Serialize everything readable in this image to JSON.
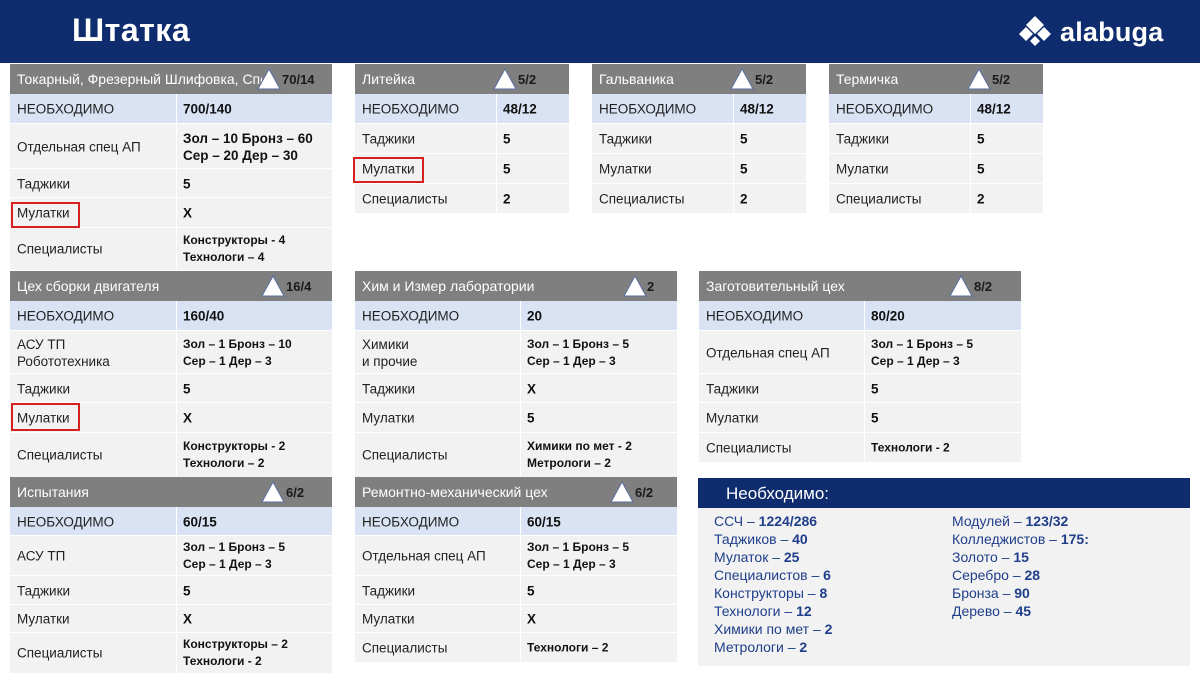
{
  "header": {
    "title": "Штатка",
    "logo_text": "alabuga"
  },
  "colors": {
    "header_bg": "#0f2d6e",
    "block_header": "#7f7f7f",
    "row_blue": "#dae3f3",
    "row_gray": "#f2f2f2",
    "highlight": "#d42020"
  },
  "blocks": {
    "tokarny": {
      "title": "Токарный, Фрезерный Шлифовка, Спец",
      "count": "70/14",
      "rows": [
        {
          "label": "НЕОБХОДИМО",
          "value": "700/140"
        },
        {
          "label": "Отдельная спец АП",
          "line1": "Зол – 10  Бронз – 60",
          "line2": "Сер – 20  Дер – 30"
        },
        {
          "label": "Таджики",
          "value": "5"
        },
        {
          "label": "Мулатки",
          "value": "X"
        },
        {
          "label": "Специалисты",
          "line1": "Конструкторы - 4",
          "line2": "Технологи – 4"
        }
      ]
    },
    "liteyka": {
      "title": "Литейка",
      "count": "5/2",
      "rows": [
        {
          "label": "НЕОБХОДИМО",
          "value": "48/12"
        },
        {
          "label": "Таджики",
          "value": "5"
        },
        {
          "label": "Мулатки",
          "value": "5"
        },
        {
          "label": "Специалисты",
          "value": "2"
        }
      ]
    },
    "galvanika": {
      "title": "Гальваника",
      "count": "5/2",
      "rows": [
        {
          "label": "НЕОБХОДИМО",
          "value": "48/12"
        },
        {
          "label": "Таджики",
          "value": "5"
        },
        {
          "label": "Мулатки",
          "value": "5"
        },
        {
          "label": "Специалисты",
          "value": "2"
        }
      ]
    },
    "termichka": {
      "title": "Термичка",
      "count": "5/2",
      "rows": [
        {
          "label": "НЕОБХОДИМО",
          "value": "48/12"
        },
        {
          "label": "Таджики",
          "value": "5"
        },
        {
          "label": "Мулатки",
          "value": "5"
        },
        {
          "label": "Специалисты",
          "value": "2"
        }
      ]
    },
    "sborka": {
      "title": "Цех сборки двигателя",
      "count": "16/4",
      "rows": [
        {
          "label": "НЕОБХОДИМО",
          "value": "160/40"
        },
        {
          "label1": "АСУ ТП",
          "label2": "Робототехника",
          "line1": "Зол – 1   Бронз – 10",
          "line2": "Сер – 1   Дер – 3"
        },
        {
          "label": "Таджики",
          "value": "5"
        },
        {
          "label": "Мулатки",
          "value": "X"
        },
        {
          "label": "Специалисты",
          "line1": "Конструкторы - 2",
          "line2": "Технологи – 2"
        }
      ]
    },
    "khim": {
      "title": "Хим и Измер лаборатории",
      "count": "2",
      "rows": [
        {
          "label": "НЕОБХОДИМО",
          "value": "20"
        },
        {
          "label1": "Химики",
          "label2": "и прочие",
          "line1": "Зол – 1   Бронз – 5",
          "line2": "Сер – 1   Дер – 3"
        },
        {
          "label": "Таджики",
          "value": "X"
        },
        {
          "label": "Мулатки",
          "value": "5"
        },
        {
          "label": "Специалисты",
          "line1": "Химики по мет - 2",
          "line2": "Метрологи – 2"
        }
      ]
    },
    "zagotov": {
      "title": "Заготовительный цех",
      "count": "8/2",
      "rows": [
        {
          "label": "НЕОБХОДИМО",
          "value": "80/20"
        },
        {
          "label": "Отдельная спец АП",
          "line1": "Зол – 1   Бронз – 5",
          "line2": "Сер – 1   Дер – 3"
        },
        {
          "label": "Таджики",
          "value": "5"
        },
        {
          "label": "Мулатки",
          "value": "5"
        },
        {
          "label": "Специалисты",
          "value": "Технологи - 2"
        }
      ]
    },
    "ispytaniya": {
      "title": "Испытания",
      "count": "6/2",
      "rows": [
        {
          "label": "НЕОБХОДИМО",
          "value": "60/15"
        },
        {
          "label": "АСУ ТП",
          "line1": "Зол – 1   Бронз – 5",
          "line2": "Сер – 1   Дер – 3"
        },
        {
          "label": "Таджики",
          "value": "5"
        },
        {
          "label": "Мулатки",
          "value": "X"
        },
        {
          "label": "Специалисты",
          "line1": "Конструкторы – 2",
          "line2": "Технологи - 2"
        }
      ]
    },
    "remont": {
      "title": "Ремонтно-механический цех",
      "count": "6/2",
      "rows": [
        {
          "label": "НЕОБХОДИМО",
          "value": "60/15"
        },
        {
          "label": "Отдельная спец АП",
          "line1": "Зол – 1   Бронз – 5",
          "line2": "Сер – 1   Дер – 3"
        },
        {
          "label": "Таджики",
          "value": "5"
        },
        {
          "label": "Мулатки",
          "value": "X"
        },
        {
          "label": "Специалисты",
          "value": "Технологи – 2"
        }
      ]
    }
  },
  "summary": {
    "title": "Необходимо:",
    "left": [
      {
        "label": "ССЧ – ",
        "value": "1224/286"
      },
      {
        "label": "Таджиков – ",
        "value": "40"
      },
      {
        "label": "Мулаток – ",
        "value": "25"
      },
      {
        "label": "Специалистов – ",
        "value": "6"
      },
      {
        "label": "Конструкторы – ",
        "value": "8"
      },
      {
        "label": "Технологи – ",
        "value": "12"
      },
      {
        "label": "Химики по мет – ",
        "value": "2"
      },
      {
        "label": "Метрологи – ",
        "value": "2"
      }
    ],
    "right": [
      {
        "label": "Модулей – ",
        "value": "123/32"
      },
      {
        "label": "Колледжистов – ",
        "value": "175:"
      },
      {
        "label": "Золото – ",
        "value": "15"
      },
      {
        "label": "Серебро – ",
        "value": "28"
      },
      {
        "label": "Бронза – ",
        "value": "90"
      },
      {
        "label": "Дерево – ",
        "value": "45"
      }
    ]
  }
}
